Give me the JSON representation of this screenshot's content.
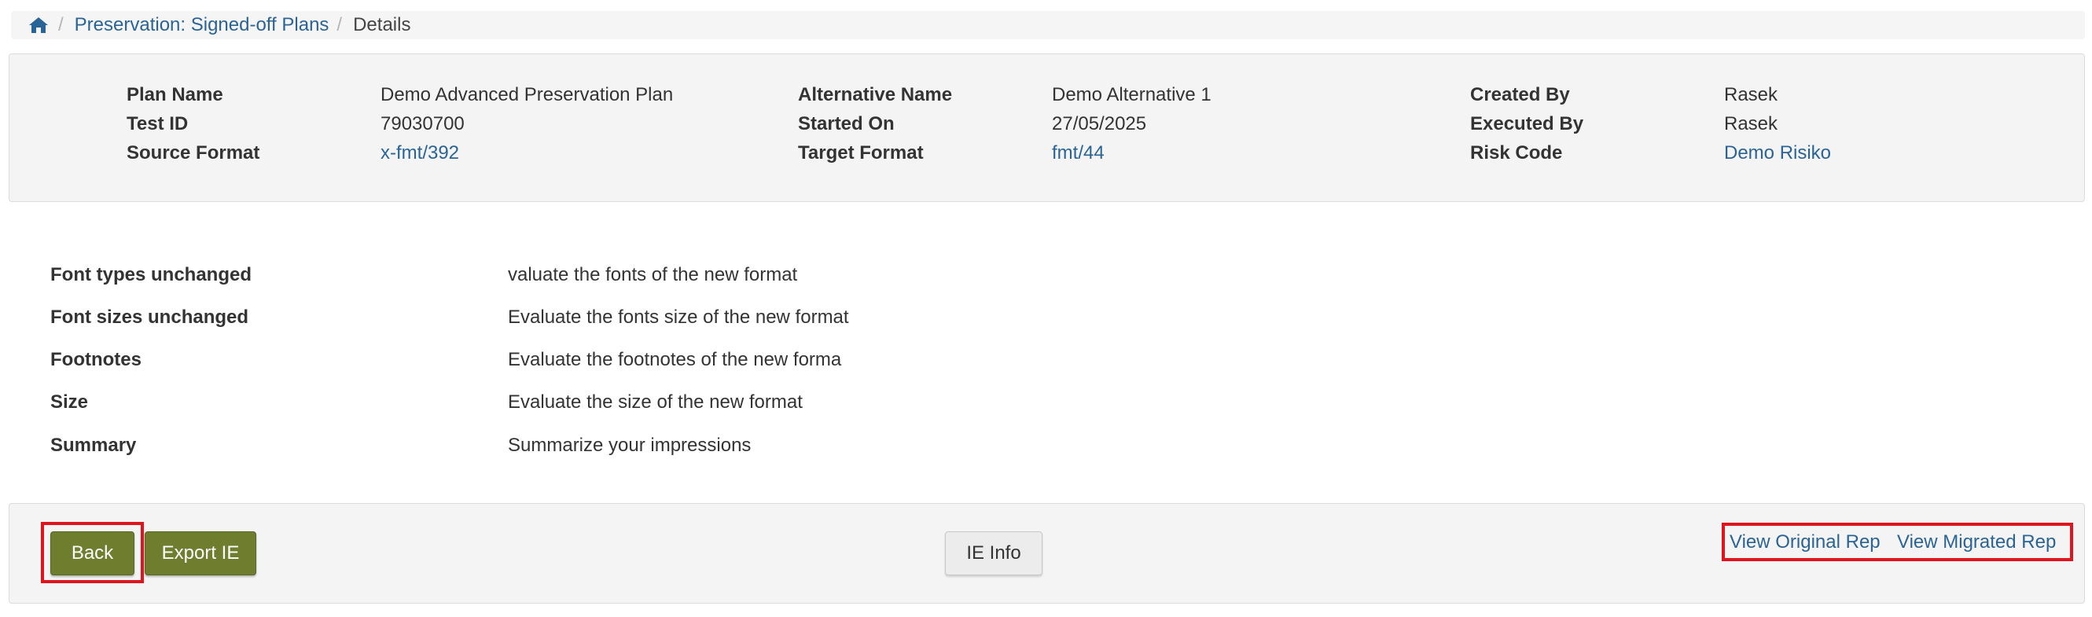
{
  "breadcrumb": {
    "home_icon": "home-icon",
    "separator": "/",
    "items": [
      "Preservation: Signed-off Plans",
      "Details"
    ]
  },
  "plan_info": {
    "plan_name": {
      "label": "Plan Name",
      "value": "Demo Advanced Preservation Plan"
    },
    "test_id": {
      "label": "Test ID",
      "value": "79030700"
    },
    "source_format": {
      "label": "Source Format",
      "value": "x-fmt/392"
    },
    "alternative_name": {
      "label": "Alternative Name",
      "value": "Demo Alternative 1"
    },
    "started_on": {
      "label": "Started On",
      "value": "27/05/2025"
    },
    "target_format": {
      "label": "Target Format",
      "value": "fmt/44"
    },
    "created_by": {
      "label": "Created By",
      "value": "Rasek"
    },
    "executed_by": {
      "label": "Executed By",
      "value": "Rasek"
    },
    "risk_code": {
      "label": "Risk Code",
      "value": "Demo Risiko"
    }
  },
  "criteria": [
    {
      "name": "Font types unchanged",
      "description": "valuate the fonts of the new format"
    },
    {
      "name": "Font sizes unchanged",
      "description": "Evaluate the fonts size of the new format"
    },
    {
      "name": "Footnotes",
      "description": "Evaluate the footnotes of the new forma"
    },
    {
      "name": "Size",
      "description": "Evaluate the size of the new format"
    },
    {
      "name": "Summary",
      "description": "Summarize your impressions"
    }
  ],
  "actions": {
    "back": "Back",
    "export_ie": "Export IE",
    "ie_info": "IE Info",
    "view_original_rep": "View Original Rep",
    "view_migrated_rep": "View Migrated Rep"
  },
  "colors": {
    "link": "#2a6496",
    "primary_button": "#6e7d2e",
    "highlight": "#e0141c"
  }
}
